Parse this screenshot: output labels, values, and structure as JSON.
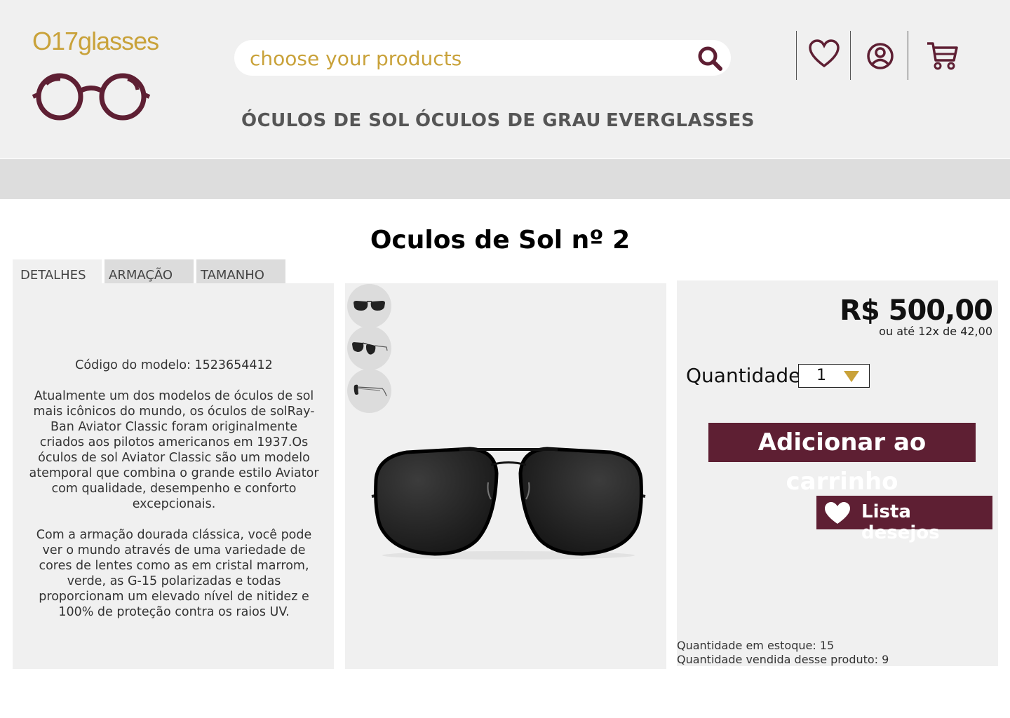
{
  "brand": {
    "name": "O17glasses",
    "primary_color": "#5e1f33",
    "accent_color": "#c9a23a"
  },
  "search": {
    "placeholder": "choose your products"
  },
  "header_icons": [
    "heart-icon",
    "user-icon",
    "cart-icon"
  ],
  "nav": {
    "items": [
      "ÓCULOS DE SOL",
      "ÓCULOS DE GRAU",
      "EVERGLASSES"
    ]
  },
  "product": {
    "title": "Oculos de Sol nº 2",
    "tabs": [
      "DETALHES",
      "ARMAÇÃO",
      "TAMANHO"
    ],
    "description": {
      "model_code": "Código do modelo: 1523654412",
      "paragraph_1": "Atualmente um dos modelos de óculos de sol mais icônicos do mundo, os óculos de solRay-Ban Aviator Classic foram originalmente criados aos pilotos americanos em 1937.Os óculos de sol Aviator Classic são um modelo atemporal que combina o grande estilo Aviator com qualidade, desempenho e conforto excepcionais.",
      "paragraph_2": "Com a armação dourada clássica, você pode ver o mundo através de uma variedade de cores de lentes como as em cristal marrom, verde, as G-15 polarizadas e todas proporcionam um elevado nível de nitidez e 100% de proteção contra os raios UV."
    },
    "price": "R$ 500,00",
    "installments": "ou até 12x de 42,00",
    "quantity_label": "Quantidade:",
    "quantity_value": "1",
    "add_to_cart": "Adicionar ao carrinho",
    "wishlist": "Lista desejos",
    "stock": "Quantidade em estoque: 15",
    "sold": "Quantidade vendida desse produto: 9"
  }
}
